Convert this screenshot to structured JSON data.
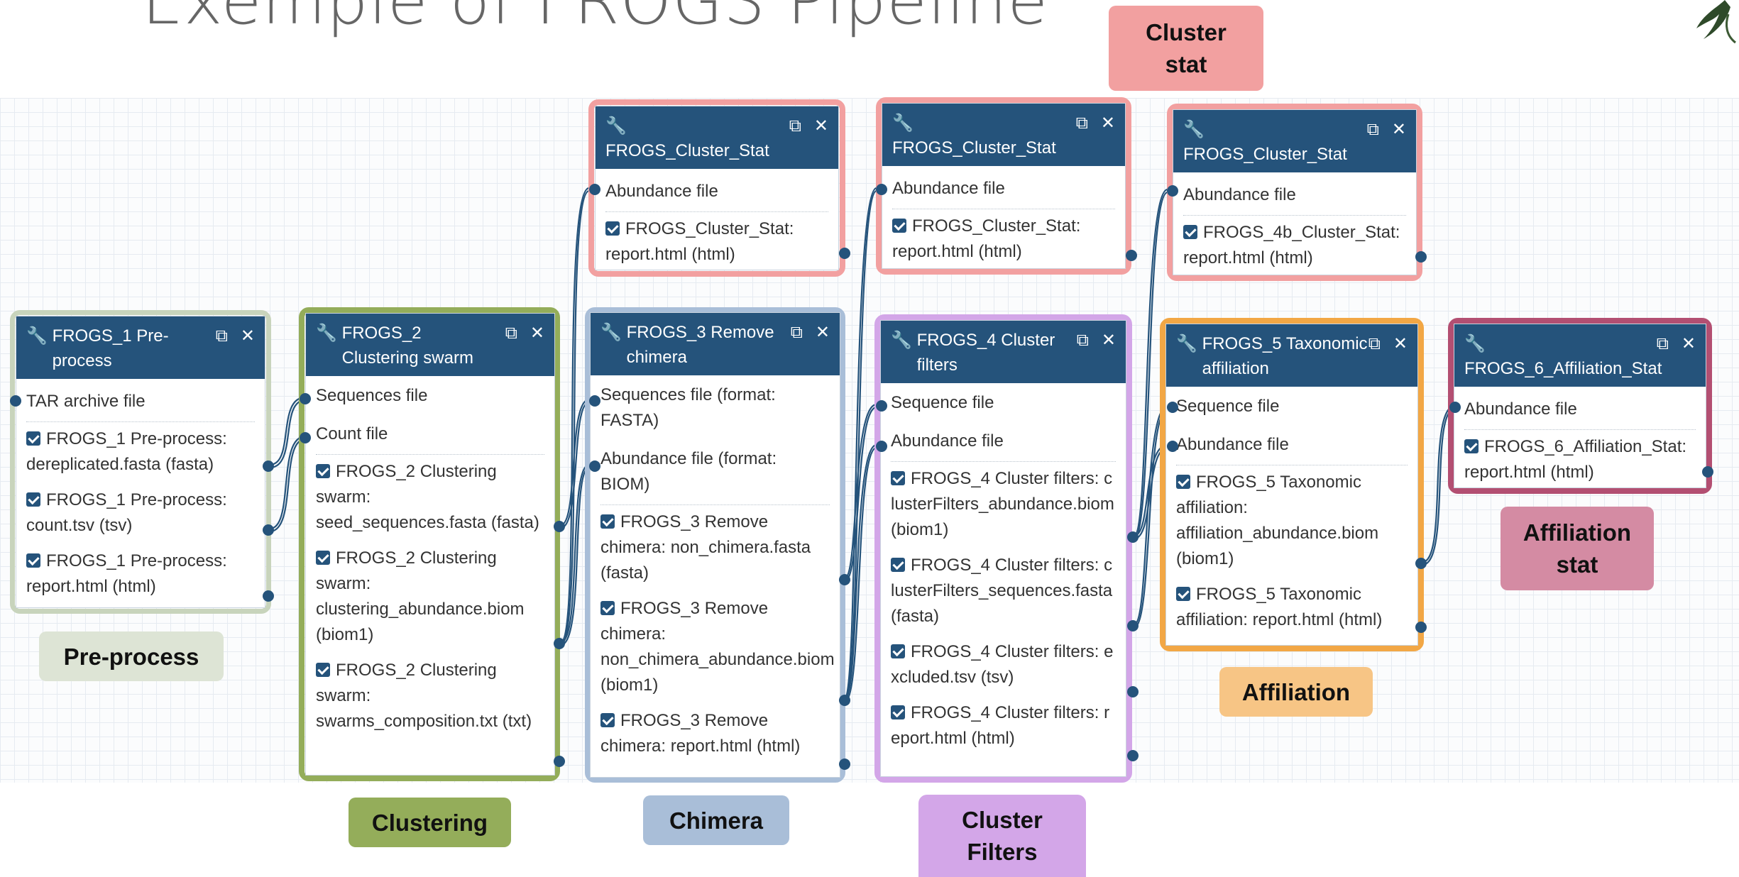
{
  "title": "Exemple of FROGS Pipeline",
  "nodes": [
    {
      "title": "FROGS_1 Pre-process",
      "inputs": [
        "TAR archive file"
      ],
      "outputs": [
        "FROGS_1 Pre-process: dereplicated.fasta (fasta)",
        "FROGS_1 Pre-process: count.tsv (tsv)",
        "FROGS_1 Pre-process: report.html (html)"
      ]
    },
    {
      "title": "FROGS_2 Clustering swarm",
      "inputs": [
        "Sequences file",
        "Count file"
      ],
      "outputs": [
        "FROGS_2 Clustering swarm: seed_sequences.fasta (fasta)",
        "FROGS_2 Clustering swarm: clustering_abundance.biom (biom1)",
        "FROGS_2 Clustering swarm: swarms_composition.txt (txt)"
      ]
    },
    {
      "title": "FROGS_Cluster_Stat",
      "inputs": [
        "Abundance file"
      ],
      "outputs": [
        "FROGS_Cluster_Stat: report.html (html)"
      ]
    },
    {
      "title": "FROGS_3 Remove chimera",
      "inputs": [
        "Sequences file (format: FASTA)",
        "Abundance file (format: BIOM)"
      ],
      "outputs": [
        "FROGS_3 Remove chimera: non_chimera.fasta (fasta)",
        "FROGS_3 Remove chimera: non_chimera_abundance.biom (biom1)",
        "FROGS_3 Remove chimera: report.html (html)"
      ]
    },
    {
      "title": "FROGS_Cluster_Stat",
      "inputs": [
        "Abundance file"
      ],
      "outputs": [
        "FROGS_Cluster_Stat: report.html (html)"
      ]
    },
    {
      "title": "FROGS_4 Cluster filters",
      "inputs": [
        "Sequence file",
        "Abundance file"
      ],
      "outputs": [
        "FROGS_4 Cluster filters: clusterFilters_abundance.biom (biom1)",
        "FROGS_4 Cluster filters: clusterFilters_sequences.fasta (fasta)",
        "FROGS_4 Cluster filters: excluded.tsv (tsv)",
        "FROGS_4 Cluster filters: report.html (html)"
      ]
    },
    {
      "title": "FROGS_Cluster_Stat",
      "inputs": [
        "Abundance file"
      ],
      "outputs": [
        "FROGS_4b_Cluster_Stat: report.html (html)"
      ]
    },
    {
      "title": "FROGS_5 Taxonomic affiliation",
      "inputs": [
        "Sequence file",
        "Abundance file"
      ],
      "outputs": [
        "FROGS_5 Taxonomic affiliation: affiliation_abundance.biom (biom1)",
        "FROGS_5 Taxonomic affiliation: report.html (html)"
      ]
    },
    {
      "title": "FROGS_6_Affiliation_Stat",
      "inputs": [
        "Abundance file"
      ],
      "outputs": [
        "FROGS_6_Affiliation_Stat: report.html (html)"
      ]
    }
  ],
  "labels": {
    "preprocess": "Pre-process",
    "clustering": "Clustering",
    "chimera": "Chimera",
    "cluster_filters": "Cluster\nFilters",
    "affiliation": "Affiliation",
    "affiliation_stat": "Affiliation\nstat",
    "cluster_stat": "Cluster\nstat"
  },
  "colors": {
    "node_header": "#25537b",
    "preprocess": "#c8d4bc",
    "clustering": "#94ad5a",
    "chimera": "#a9bed8",
    "cluster_filters": "#d3a6e8",
    "affiliation": "#f2a745",
    "affiliation_stat": "#b34f72",
    "cluster_stat": "#f2a0a0"
  },
  "icons": [
    "wrench-icon",
    "copy-icon",
    "close-icon",
    "checkbox-icon",
    "plant-icon"
  ]
}
